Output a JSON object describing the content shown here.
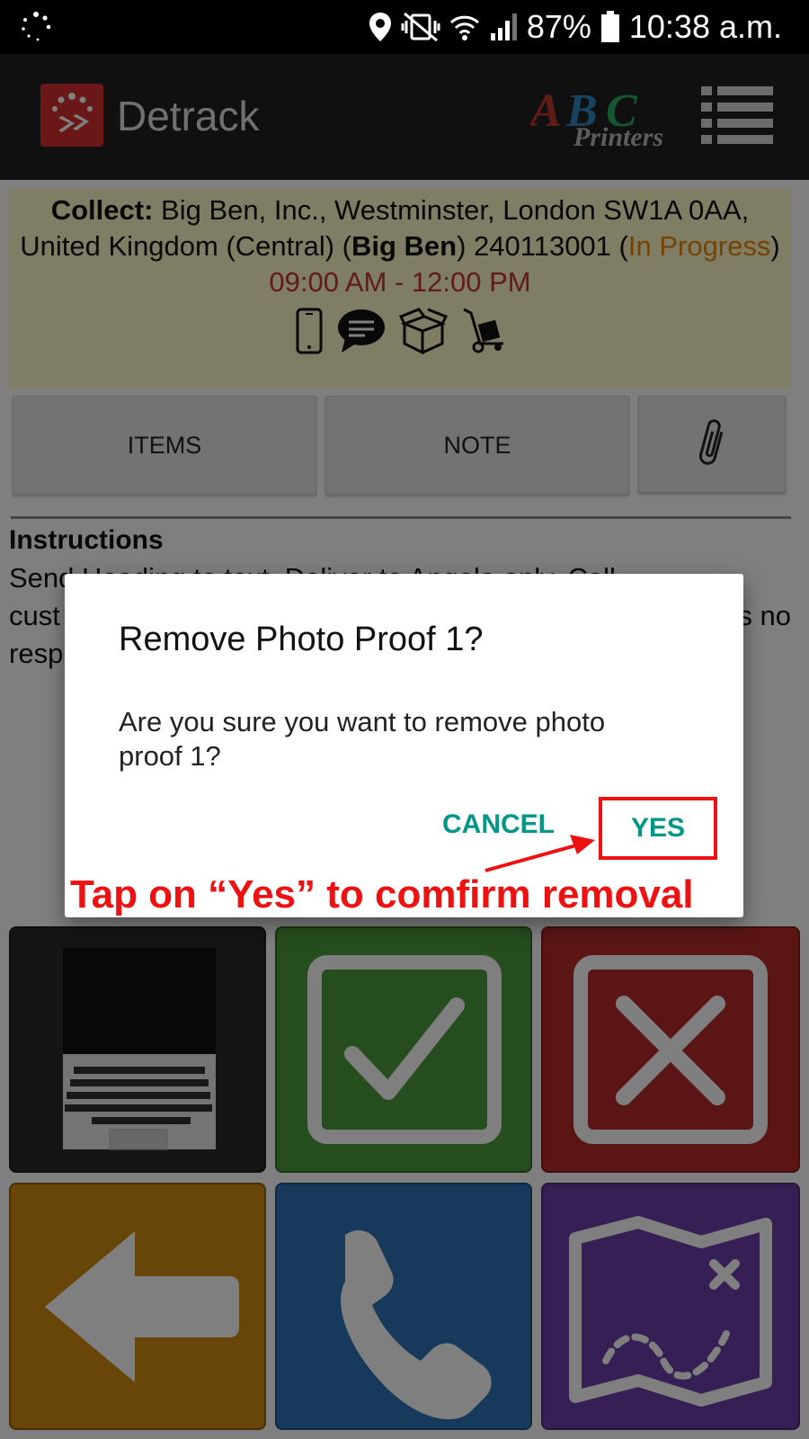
{
  "status_bar": {
    "battery": "87%",
    "time": "10:38 a.m.",
    "icons": [
      "sync-spinner-icon",
      "location-pin-icon",
      "vibrate-mute-icon",
      "wifi-icon",
      "cell-signal-icon",
      "battery-icon"
    ]
  },
  "app_bar": {
    "title": "Detrack",
    "brand_logo": {
      "letters": [
        "A",
        "B",
        "C"
      ],
      "word": "Printers"
    },
    "menu_icon": "menu-list-icon"
  },
  "job": {
    "collect_label": "Collect:",
    "address": "Big Ben, Inc., Westminster, London SW1A 0AA, United Kingdom (Central) (",
    "name": "Big Ben",
    "tracking": ") 240113001 (",
    "status": "In Progress",
    "status_close": ")",
    "time_window": "09:00 AM - 12:00 PM",
    "icons": [
      "phone-icon",
      "chat-icon",
      "box-icon",
      "hand-truck-icon"
    ]
  },
  "tabs": {
    "items": "ITEMS",
    "note": "NOTE",
    "attach_icon": "paperclip-icon"
  },
  "instructions": {
    "title": "Instructions",
    "line1": "Send Heading to text. Deliver to Angela only. Call",
    "line2_start": "cust",
    "line2_end": "s no",
    "line3": "resp"
  },
  "tiles": [
    {
      "name": "photo-proof",
      "color": "#2a2a2a"
    },
    {
      "name": "complete",
      "color": "#4a9a3a"
    },
    {
      "name": "fail",
      "color": "#b82a2a"
    },
    {
      "name": "back",
      "color": "#d08a10"
    },
    {
      "name": "call",
      "color": "#2f73b8"
    },
    {
      "name": "map",
      "color": "#6a3fa8"
    }
  ],
  "dialog": {
    "title": "Remove Photo Proof 1?",
    "message": "Are you sure you want to remove photo proof 1?",
    "cancel": "CANCEL",
    "confirm": "YES"
  },
  "annotation": {
    "text": "Tap on “Yes” to comfirm removal",
    "color": "#ee1111"
  }
}
